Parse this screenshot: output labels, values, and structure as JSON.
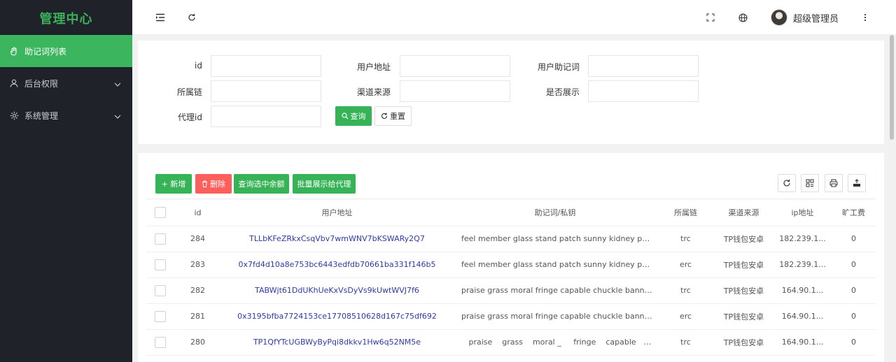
{
  "sidebar": {
    "logo": "管理中心",
    "items": [
      {
        "label": "助记词列表",
        "icon": "hand-icon",
        "active": true
      },
      {
        "label": "后台权限",
        "icon": "user-icon"
      },
      {
        "label": "系统管理",
        "icon": "gear-icon"
      }
    ]
  },
  "header": {
    "user_name": "超级管理员"
  },
  "search": {
    "labels": {
      "id": "id",
      "address": "用户地址",
      "mnemonic": "用户助记词",
      "chain": "所属链",
      "channel": "渠道来源",
      "show": "是否展示",
      "agent": "代理id"
    },
    "query_button": "查询",
    "reset_button": "重置"
  },
  "toolbar": {
    "add": "+ 新增",
    "delete": "删除",
    "query_balance": "查询选中余额",
    "batch_show": "批量展示给代理"
  },
  "table": {
    "columns": [
      "id",
      "用户地址",
      "助记词/私钥",
      "所属链",
      "渠道来源",
      "ip地址",
      "旷工费"
    ],
    "rows": [
      {
        "id": "284",
        "address": "TLLbKFeZRkxCsqVbv7wmWNV7bKSWARy2Q7",
        "mnemonic": "feel member glass stand patch sunny kidney phone f...",
        "chain": "trc",
        "channel": "TP钱包安卓",
        "ip": "182.239.1...",
        "fee": "0"
      },
      {
        "id": "283",
        "address": "0x7fd4d10a8e753bc6443edfdb70661ba331f146b5",
        "mnemonic": "feel member glass stand patch sunny kidney phone f...",
        "chain": "erc",
        "channel": "TP钱包安卓",
        "ip": "182.239.1...",
        "fee": "0"
      },
      {
        "id": "282",
        "address": "TABWjt61DdUKhUeKxVsDyVs9kUwtWVJ7f6",
        "mnemonic": "praise grass moral fringe capable chuckle banner sp...",
        "chain": "trc",
        "channel": "TP钱包安卓",
        "ip": "164.90.1...",
        "fee": "0"
      },
      {
        "id": "281",
        "address": "0x3195bfba7724153ce17708510628d167c75df692",
        "mnemonic": "praise grass moral fringe capable chuckle banner sp...",
        "chain": "erc",
        "channel": "TP钱包安卓",
        "ip": "164.90.1...",
        "fee": "0"
      },
      {
        "id": "280",
        "address": "TP1QfYTcUGBWyByPqi8dkkv1Hw6q52NM5e",
        "mnemonic": "   praise    grass    moral _     fringe    capable   chu...",
        "chain": "trc",
        "channel": "TP钱包安卓",
        "ip": "164.90.1...",
        "fee": "0"
      }
    ]
  },
  "colors": {
    "sidebar_bg": "#20222a",
    "accent_green": "#3bb55e",
    "danger_red": "#ff5f5a",
    "link_blue": "#2e3aa8"
  }
}
